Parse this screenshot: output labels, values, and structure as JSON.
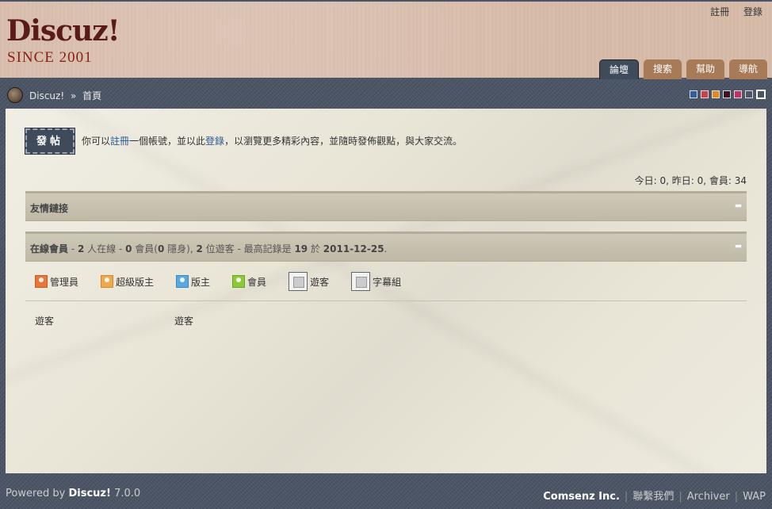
{
  "header": {
    "logo": "Discuz!",
    "since": "SINCE 2001",
    "toplinks": [
      "註冊",
      "登錄"
    ],
    "tabs": [
      {
        "label": "論壇",
        "active": true
      },
      {
        "label": "搜索",
        "active": false
      },
      {
        "label": "幫助",
        "active": false
      },
      {
        "label": "導航",
        "active": false
      }
    ]
  },
  "nav": {
    "site": "Discuz!",
    "separator": "»",
    "page": "首頁",
    "swatch_colors": [
      "#2f5fa3",
      "#d0404c",
      "#e08a1a",
      "#3a1424",
      "#c0306a",
      "#4b5566"
    ]
  },
  "main": {
    "post_button": "發帖",
    "intro_prefix": "你可以",
    "intro_register": "註冊",
    "intro_mid": "一個帳號，並以此",
    "intro_login": "登錄",
    "intro_suffix": "，以瀏覽更多精彩內容，並隨時發佈觀點，與大家交流。",
    "stats": "今日: 0, 昨日: 0, 會員: 34",
    "friends_title": "友情鏈接",
    "online": {
      "title": "在線會員",
      "summary_1": " - ",
      "count_total": "2",
      "summary_2": " 人在線 - ",
      "count_members": "0",
      "summary_3": " 會員(",
      "count_hidden": "0",
      "summary_4": " 隱身), ",
      "count_guests": "2",
      "summary_5": " 位遊客 - 最高記錄是 ",
      "record": "19",
      "summary_6": " 於 ",
      "record_date": "2011-12-25",
      "summary_7": "."
    },
    "legend": [
      {
        "label": "管理員",
        "color": "#e8763a"
      },
      {
        "label": "超級版主",
        "color": "#f0a84a"
      },
      {
        "label": "版主",
        "color": "#5aa8e0"
      },
      {
        "label": "會員",
        "color": "#8cc83a"
      },
      {
        "label": "遊客",
        "color": "#cccccc"
      },
      {
        "label": "字幕組",
        "color": "#cccccc"
      }
    ],
    "online_users": [
      "遊客",
      "遊客"
    ]
  },
  "footer": {
    "powered_prefix": "Powered by ",
    "powered_name": "Discuz!",
    "powered_version": " 7.0.0",
    "company": "Comsenz Inc.",
    "links": [
      "聯繫我們",
      "Archiver",
      "WAP"
    ]
  }
}
